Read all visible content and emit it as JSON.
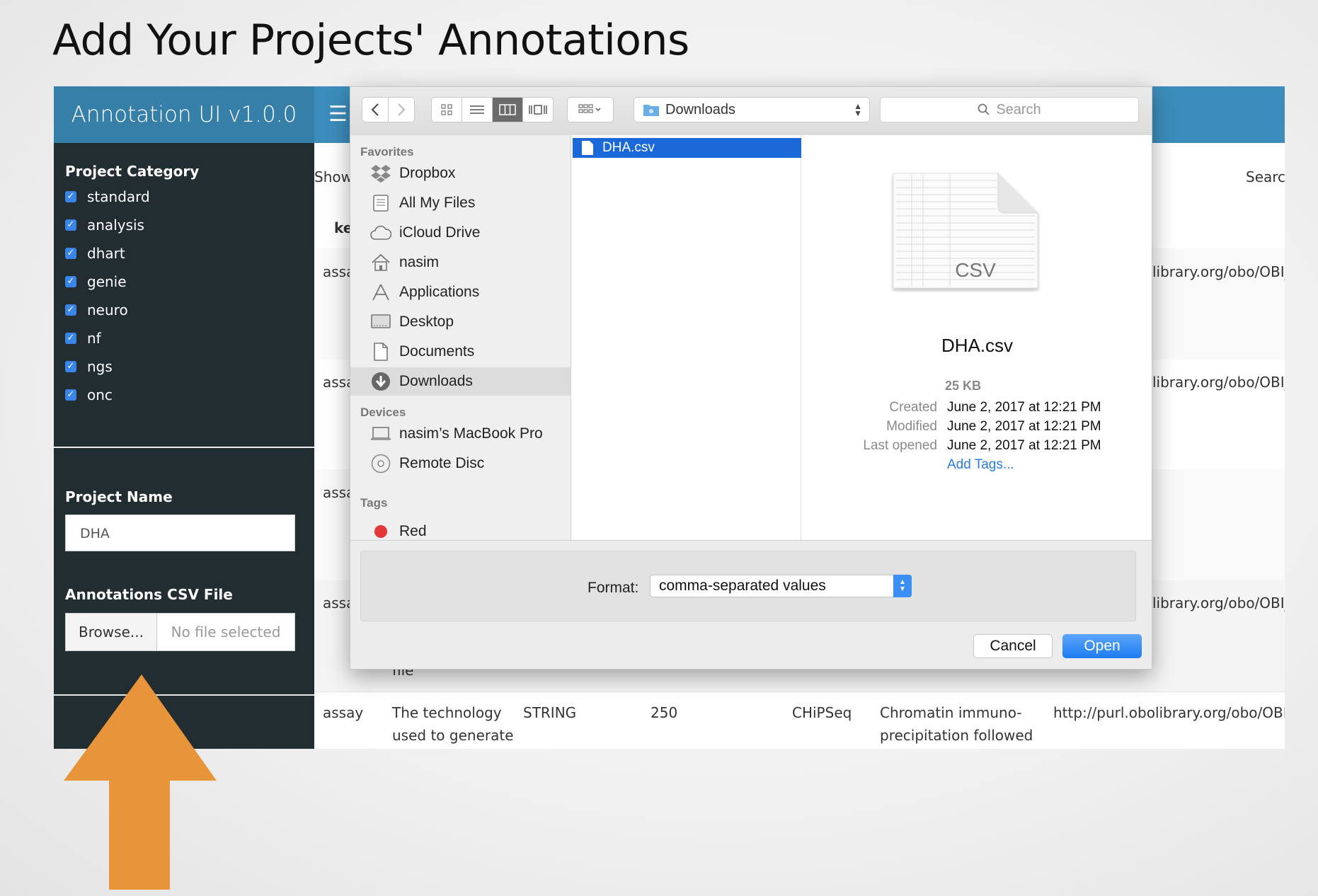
{
  "slide": {
    "title": "Add Your Projects' Annotations"
  },
  "app": {
    "brand": "Annotation UI v1.0.0",
    "menu_icon": "hamburger-icon",
    "sidebar": {
      "category_heading": "Project Category",
      "categories": [
        "standard",
        "analysis",
        "dhart",
        "genie",
        "neuro",
        "nf",
        "ngs",
        "onc"
      ],
      "project_name_label": "Project Name",
      "project_name_value": "DHA",
      "csv_label": "Annotations CSV File",
      "browse_label": "Browse...",
      "no_file_label": "No file selected"
    },
    "table": {
      "show_label": "Show",
      "search_label": "Searcl",
      "header_fragment": "ke",
      "row_fragments": [
        "assa",
        "assa",
        "assa",
        "assa"
      ],
      "url_fragment": "library.org/obo/OBI_",
      "cell_fragment": "file",
      "last_row": [
        "assay",
        "The technology",
        "used to generate",
        "STRING",
        "250",
        "CHiPSeq",
        "Chromatin immuno-",
        "precipitation followed",
        "http://purl.obolibrary.org/obo/OBI_"
      ]
    }
  },
  "dialog": {
    "location": "Downloads",
    "search_placeholder": "Search",
    "sidebar": {
      "favorites_heading": "Favorites",
      "favorites": [
        {
          "label": "Dropbox",
          "icon": "dropbox-icon"
        },
        {
          "label": "All My Files",
          "icon": "all-files-icon"
        },
        {
          "label": "iCloud Drive",
          "icon": "cloud-icon"
        },
        {
          "label": "nasim",
          "icon": "home-icon"
        },
        {
          "label": "Applications",
          "icon": "applications-icon"
        },
        {
          "label": "Desktop",
          "icon": "desktop-icon"
        },
        {
          "label": "Documents",
          "icon": "documents-icon"
        },
        {
          "label": "Downloads",
          "icon": "downloads-icon",
          "selected": true
        }
      ],
      "devices_heading": "Devices",
      "devices": [
        {
          "label": "nasim’s MacBook Pro",
          "icon": "laptop-icon"
        },
        {
          "label": "Remote Disc",
          "icon": "disc-icon"
        }
      ],
      "tags_heading": "Tags",
      "tags": [
        {
          "label": "Red",
          "color": "#e5363a"
        }
      ]
    },
    "files": [
      "DHA.csv"
    ],
    "preview": {
      "badge": "CSV",
      "filename": "DHA.csv",
      "size": "25 KB",
      "created_label": "Created",
      "created": "June 2, 2017 at 12:21 PM",
      "modified_label": "Modified",
      "modified": "June 2, 2017 at 12:21 PM",
      "last_opened_label": "Last opened",
      "last_opened": "June 2, 2017 at 12:21 PM",
      "add_tags": "Add Tags..."
    },
    "format_label": "Format:",
    "format_value": "comma-separated values",
    "cancel_label": "Cancel",
    "open_label": "Open"
  },
  "colors": {
    "header": "#3c8dbc",
    "sidebar": "#222d32",
    "arrow": "#e8943a",
    "selection": "#1b69d8",
    "open_button": "#1d7cf0"
  }
}
